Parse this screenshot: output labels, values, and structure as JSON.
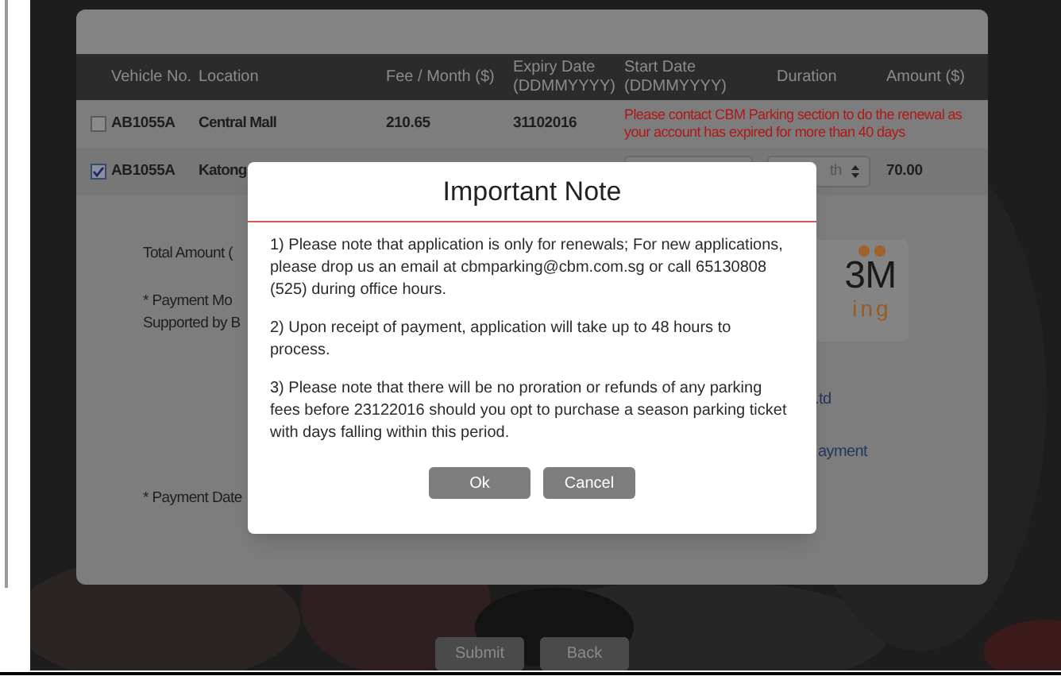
{
  "table": {
    "columns": [
      "Vehicle No.",
      "Location",
      "Fee / Month ($)",
      "Expiry Date (DDMMYYYY)",
      "Start Date (DDMMYYYY)",
      "Duration",
      "Amount ($)"
    ],
    "rows": [
      {
        "checked": false,
        "kind": "message",
        "vehicle": "AB1055A",
        "location": "Central Mall",
        "fee": "210.65",
        "expiry": "31102016",
        "message": "Please contact CBM Parking section to do the renewal as your account has expired for more than 40 days"
      },
      {
        "checked": true,
        "kind": "form",
        "vehicle": "AB1055A",
        "location": "Katong",
        "duration": "th",
        "amount": "70.00"
      }
    ]
  },
  "summary": {
    "total_label": "Total Amount (",
    "payment_mode": "* Payment Mo",
    "supported_by": "Supported by B",
    "payment_date": "* Payment Date"
  },
  "logo": {
    "mark": "3M",
    "tagline": "ing"
  },
  "links": [
    ".td",
    "ayment"
  ],
  "dialog": {
    "title": "Important Note",
    "paragraphs": [
      "1) Please note that application is only for renewals; For new applications, please drop us an email at cbmparking@cbm.com.sg or call 65130808 (525) during office hours.",
      "2) Upon receipt of payment, application will take up to 48 hours to process.",
      "3) Please note that there will be no proration or refunds of any parking fees before 23122016 should you opt to purchase a season parking ticket with days falling within this period."
    ],
    "buttons": [
      "Ok",
      "Cancel"
    ]
  },
  "footer_buttons": [
    {
      "label": "Submit",
      "disabled": true
    },
    {
      "label": "Back",
      "disabled": true
    }
  ]
}
